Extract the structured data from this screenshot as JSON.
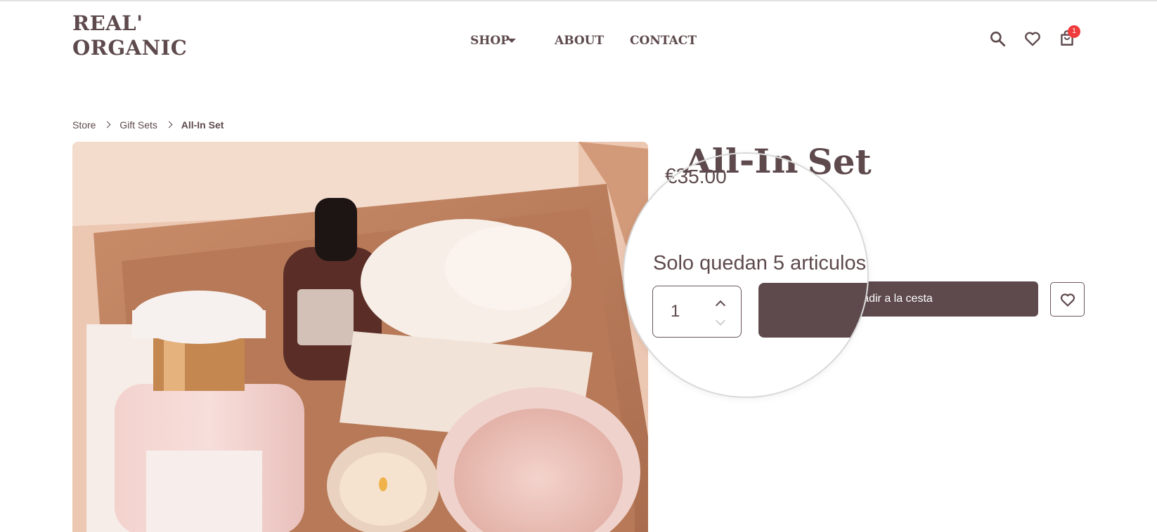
{
  "header": {
    "logo_line1": "REAL'",
    "logo_line2": "ORGANIC",
    "nav": {
      "shop": "SHOP",
      "about": "ABOUT",
      "contact": "CONTACT"
    },
    "cart_count": "1",
    "icons": [
      "search-icon",
      "heart-icon",
      "shopping-bag-icon"
    ]
  },
  "breadcrumb": {
    "items": [
      "Store",
      "Gift Sets",
      "All-In Set"
    ]
  },
  "product": {
    "title": "All-In Set",
    "price_visible": "€35.00",
    "stock_text": "Solo quedan 5 articulos.",
    "quantity": "1",
    "add_to_cart_label": "Añadir a la cesta",
    "add_to_cart_visible_partial": "adir a la cesta"
  },
  "colors": {
    "brand": "#5e4a4d",
    "badge": "#ef3b3b",
    "background": "#ffffff"
  }
}
